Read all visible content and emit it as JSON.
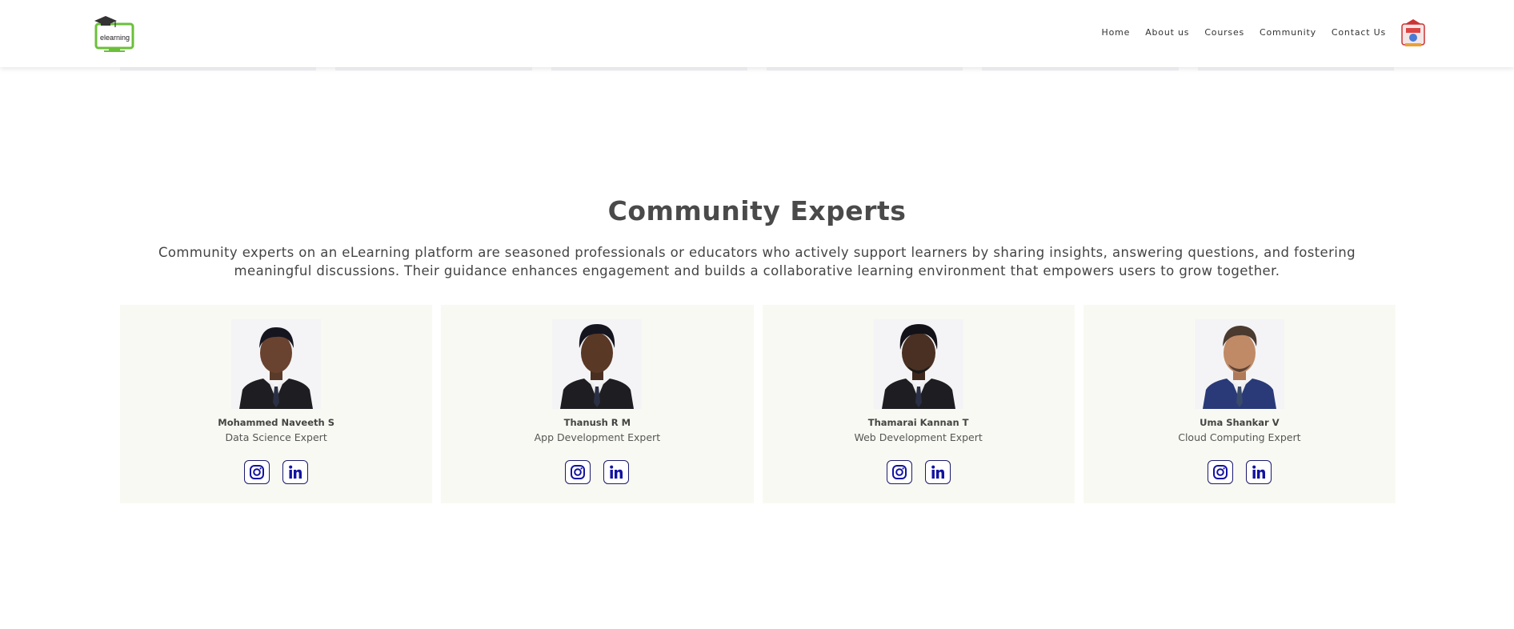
{
  "header": {
    "logo_text": "elearning",
    "nav": [
      "Home",
      "About us",
      "Courses",
      "Community",
      "Contact Us"
    ]
  },
  "section": {
    "title": "Community Experts",
    "description": "Community experts on an eLearning platform are seasoned professionals or educators who actively support learners by sharing insights, answering questions, and fostering meaningful discussions. Their guidance enhances engagement and builds a collaborative learning environment that empowers users to grow together."
  },
  "experts": [
    {
      "name": "Mohammed Naveeth S",
      "role": "Data Science Expert",
      "suit_color": "#1e1e22"
    },
    {
      "name": "Thanush R M",
      "role": "App Development Expert",
      "suit_color": "#1e1e22"
    },
    {
      "name": "Thamarai Kannan T",
      "role": "Web Development Expert",
      "suit_color": "#1e1e22"
    },
    {
      "name": "Uma Shankar V",
      "role": "Cloud Computing Expert",
      "suit_color": "#2a3a78"
    }
  ],
  "colors": {
    "card_bg": "#f9f9f3",
    "icon_color": "#1313a0",
    "logo_green": "#6bbf3a"
  },
  "icons": [
    "instagram-icon",
    "linkedin-icon"
  ]
}
